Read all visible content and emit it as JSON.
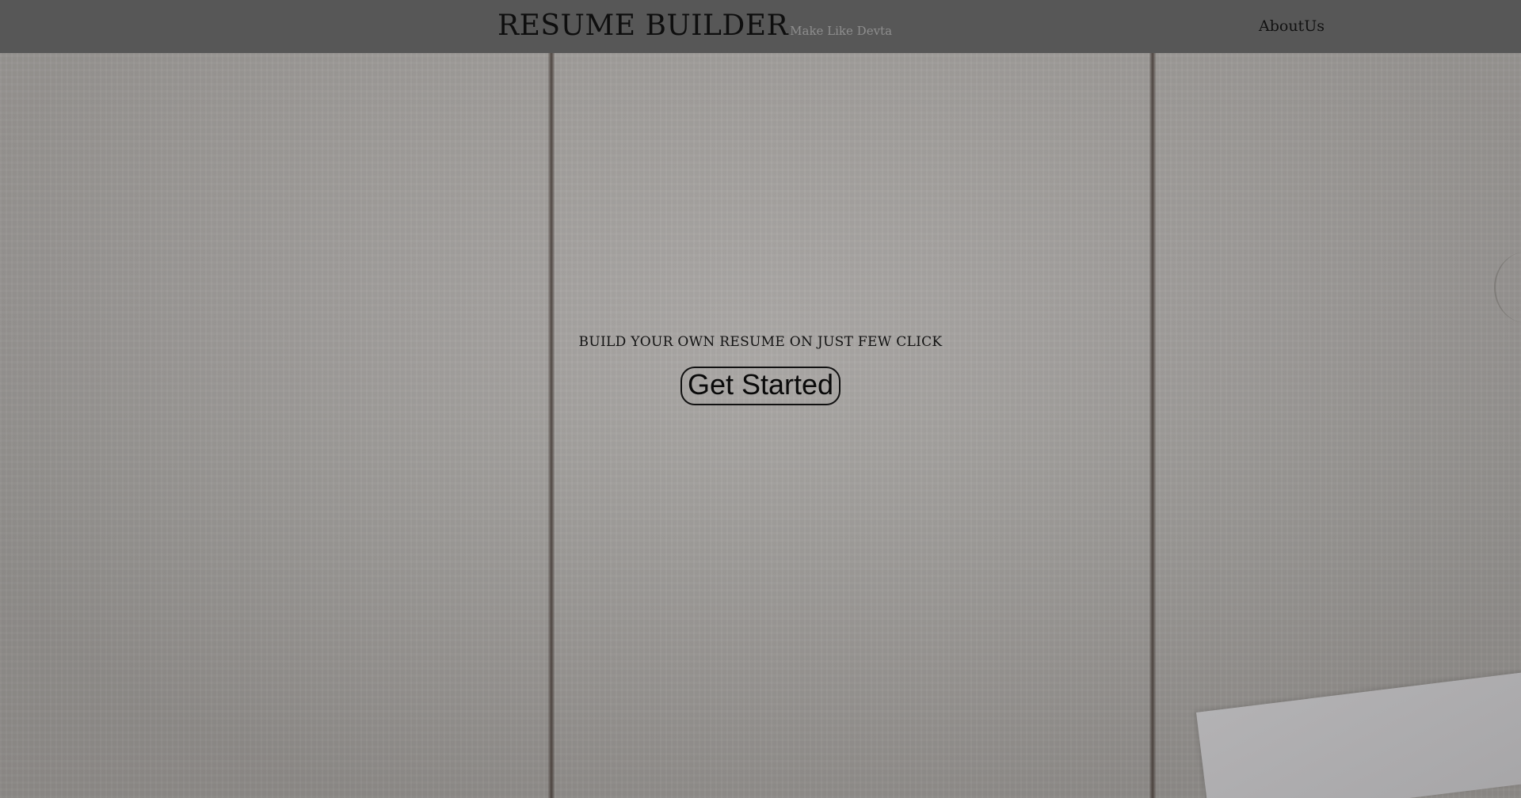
{
  "header": {
    "brand_title": "RESUME BUILDER",
    "brand_tagline": "Make Like Devta",
    "nav_links": [
      {
        "label": "AboutUs"
      }
    ]
  },
  "hero": {
    "heading": "BUILD YOUR OWN RESUME ON JUST FEW CLICK",
    "cta_label": "Get Started"
  },
  "colors": {
    "navbar_background": "#575757",
    "page_background": "#a3a09d",
    "text_primary": "#0e0e0e",
    "tagline_text": "#8e8e8e"
  }
}
